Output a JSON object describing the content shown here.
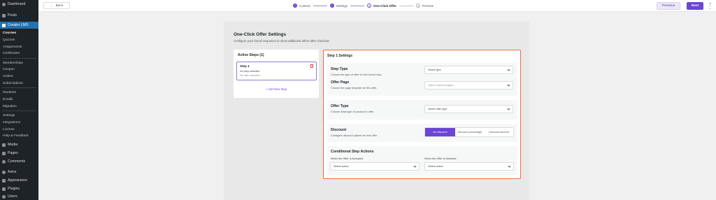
{
  "sidebar": {
    "items": [
      {
        "label": "Dashboard",
        "icon": "dashboard-icon"
      },
      {
        "label": "Posts",
        "icon": "posts-icon"
      },
      {
        "label": "Creator LMS",
        "icon": "creator-lms-icon"
      },
      {
        "label": "Courses"
      },
      {
        "label": "Quizzes"
      },
      {
        "label": "Assignments"
      },
      {
        "label": "Certificates"
      },
      {
        "label": "Memberships"
      },
      {
        "label": "Coupon"
      },
      {
        "label": "Orders"
      },
      {
        "label": "Subscriptions"
      },
      {
        "label": "Students"
      },
      {
        "label": "Emails"
      },
      {
        "label": "Migration"
      },
      {
        "label": "Settings"
      },
      {
        "label": "Integrations"
      },
      {
        "label": "License"
      },
      {
        "label": "Help & Feedback"
      },
      {
        "label": "Media",
        "icon": "media-icon"
      },
      {
        "label": "Pages",
        "icon": "pages-icon"
      },
      {
        "label": "Comments",
        "icon": "comments-icon"
      },
      {
        "label": "Astra",
        "icon": "astra-icon"
      },
      {
        "label": "Appearance",
        "icon": "appearance-icon"
      },
      {
        "label": "Plugins",
        "icon": "plugins-icon"
      },
      {
        "label": "Users",
        "icon": "users-icon"
      }
    ]
  },
  "topbar": {
    "back_label": "Back",
    "steps": [
      {
        "label": "Content",
        "state": "done"
      },
      {
        "label": "Settings",
        "state": "done"
      },
      {
        "label": "One-Click Offer",
        "state": "current",
        "num": "3"
      },
      {
        "label": "Preview",
        "state": "pending",
        "num": "4"
      }
    ],
    "previous_label": "Previous",
    "next_label": "Next"
  },
  "page": {
    "title": "One-Click Offer Settings",
    "subtitle": "Configure your funnel sequence to show additional offers after checkout"
  },
  "steps_panel": {
    "title": "Active Steps (1)",
    "step": {
      "name": "Step 1",
      "line1": "No step selected",
      "line2": "No offer selected"
    },
    "add_label": "+ Add New Step"
  },
  "settings": {
    "title": "Step 1 Settings",
    "step_type": {
      "label": "Step Type",
      "desc": "Choose the type of offer for this funnel step.",
      "value": "Select type"
    },
    "offer_page": {
      "label": "Offer Page",
      "desc": "Choose the page template for this offer.",
      "placeholder": "Type to search pages..."
    },
    "offer_type": {
      "label": "Offer Type",
      "desc": "Choose what type of product to offer.",
      "value": "Select offer type"
    },
    "discount": {
      "label": "Discount",
      "desc": "Configure discount options for this offer.",
      "options": [
        "No discount",
        "Discount percentage",
        "Discount amount"
      ],
      "selected": "No discount"
    },
    "conditional": {
      "title": "Conditional Step Actions",
      "accepted_label": "When the Offer is Accepted",
      "declined_label": "When the Offer is Declined",
      "accepted_value": "Select action",
      "declined_value": "Select action"
    }
  },
  "colors": {
    "accent": "#6b45d5",
    "highlight": "#f26b3a",
    "wp_blue": "#2271b1"
  }
}
